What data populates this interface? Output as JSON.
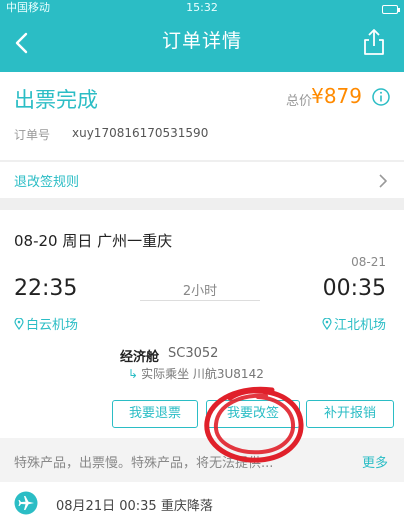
{
  "status_bar": {
    "carrier": "中国移动",
    "time": "15:32"
  },
  "nav": {
    "title": "订单详情"
  },
  "order": {
    "status": "出票完成",
    "total_label": "总价",
    "total_price": "¥879",
    "order_label": "订单号",
    "order_no": "xuy170816170531590"
  },
  "rules": {
    "label": "退改签规则"
  },
  "flight": {
    "date_route": "08-20 周日    广州一重庆",
    "arr_date": "08-21",
    "dep_time": "22:35",
    "arr_time": "00:35",
    "duration": "2小时",
    "dep_airport": "白云机场",
    "arr_airport": "江北机场",
    "cabin": "经济舱",
    "flight_no": "SC3052",
    "actual": "实际乘坐 川航3U8142"
  },
  "buttons": {
    "refund": "我要退票",
    "change": "我要改签",
    "invoice": "补开报销"
  },
  "notice": {
    "text": "特殊产品，出票慢。特殊产品，将无法提供...",
    "more": "更多"
  },
  "landing": {
    "text": "08月21日 00:35 重庆降落"
  },
  "colors": {
    "accent": "#2bbdc5",
    "price": "#ff8a00",
    "annotation": "#e0202a"
  }
}
